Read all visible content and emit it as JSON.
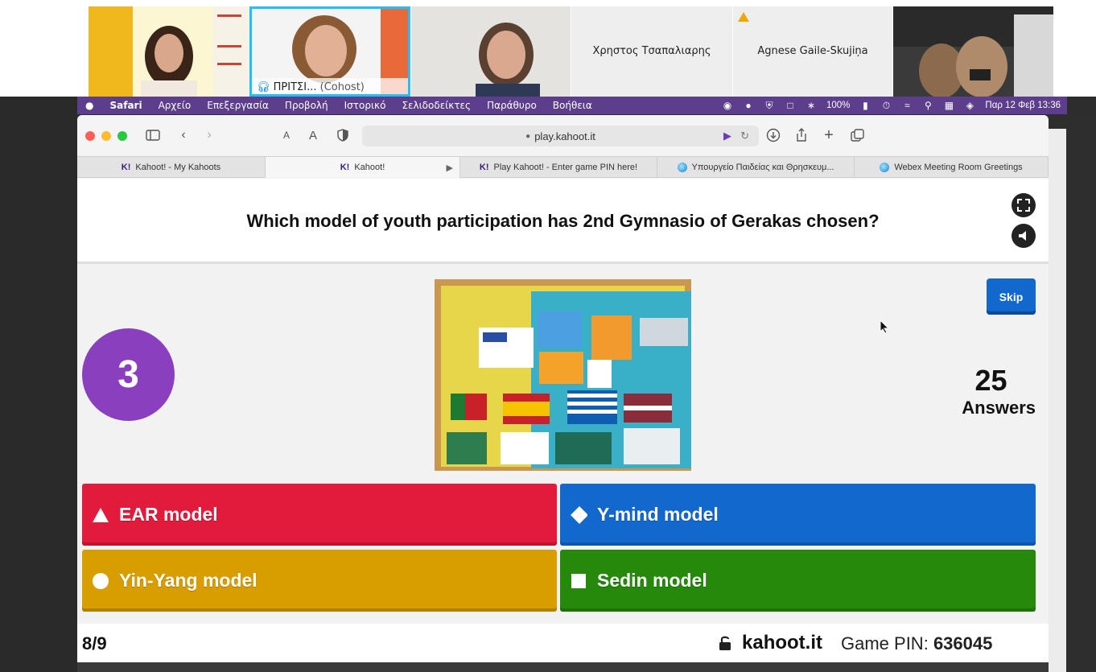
{
  "webex": {
    "participants": [
      {
        "name": "",
        "role": ""
      },
      {
        "name": "ΠΡΙΤΣΙ...",
        "role": "(Cohost)"
      },
      {
        "name": "",
        "role": ""
      },
      {
        "name": "Χρηστος Τσαπαλιαρης",
        "role": ""
      },
      {
        "name": "Agnese Gaile-Skujiņa",
        "role": ""
      },
      {
        "name": "",
        "role": ""
      }
    ]
  },
  "menubar": {
    "app": "Safari",
    "items": [
      "Αρχείο",
      "Επεξεργασία",
      "Προβολή",
      "Ιστορικό",
      "Σελιδοδείκτες",
      "Παράθυρο",
      "Βοήθεια"
    ],
    "battery": "100%",
    "clock": "Παρ 12 Φεβ  13:36"
  },
  "browser": {
    "url": "play.kahoot.it",
    "tabs": [
      {
        "label": "Kahoot! - My Kahoots",
        "icon": "kahoot-icon"
      },
      {
        "label": "Kahoot!",
        "icon": "kahoot-icon"
      },
      {
        "label": "Play Kahoot! - Enter game PIN here!",
        "icon": "kahoot-icon"
      },
      {
        "label": "Υπουργείο Παιδείας και Θρησκευμ...",
        "icon": "globe-icon"
      },
      {
        "label": "Webex Meeting Room Greetings",
        "icon": "globe-icon"
      }
    ],
    "tab_favicon_text": "K!"
  },
  "kahoot": {
    "question": "Which model of youth participation has 2nd Gymnasio of Gerakas chosen?",
    "timer": "3",
    "skip_label": "Skip",
    "answers_count": "25",
    "answers_label": "Answers",
    "answers": [
      {
        "label": "EAR model",
        "shape": "triangle",
        "color": "#e21b3c"
      },
      {
        "label": "Y-mind model",
        "shape": "diamond",
        "color": "#1368ce"
      },
      {
        "label": "Yin-Yang model",
        "shape": "circle",
        "color": "#d89e00"
      },
      {
        "label": "Sedin model",
        "shape": "square",
        "color": "#26890c"
      }
    ],
    "progress": "8/9",
    "brand": "kahoot.it",
    "pin_label": "Game PIN:",
    "pin": "636045"
  }
}
